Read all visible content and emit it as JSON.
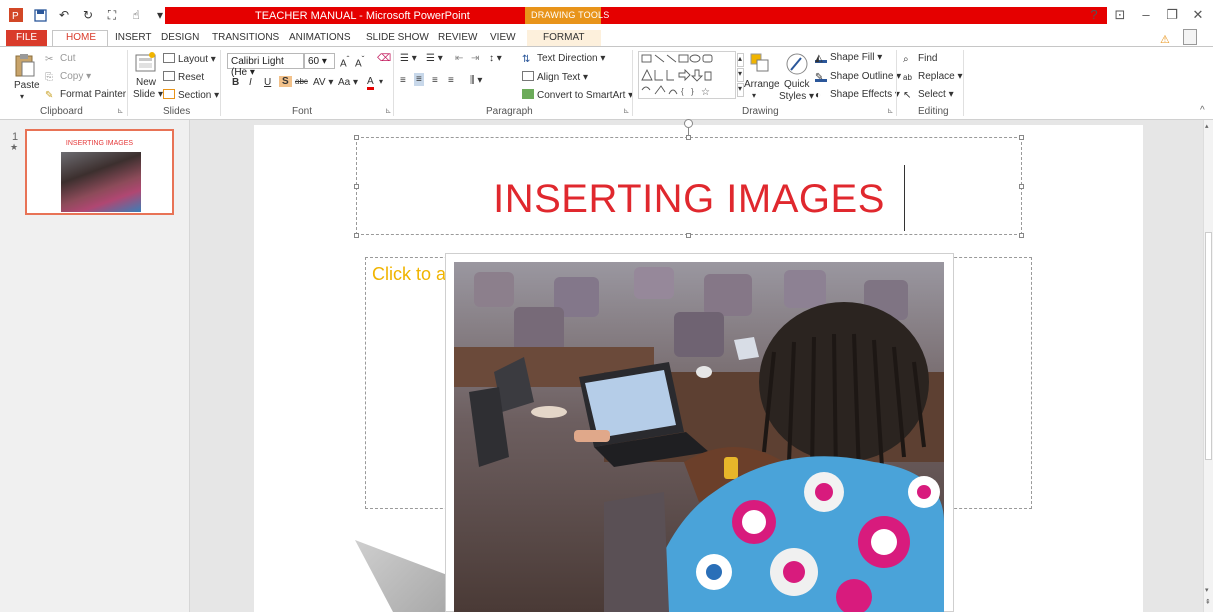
{
  "app": {
    "title": "TEACHER MANUAL - Microsoft PowerPoint",
    "contextual_tab_group": "DRAWING TOOLS",
    "window_controls": [
      "?",
      "⊡",
      "–",
      "❐",
      "✕"
    ]
  },
  "tabs": [
    "FILE",
    "HOME",
    "INSERT",
    "DESIGN",
    "TRANSITIONS",
    "ANIMATIONS",
    "SLIDE SHOW",
    "REVIEW",
    "VIEW",
    "FORMAT"
  ],
  "ribbon": {
    "clipboard": {
      "label": "Clipboard",
      "paste": "Paste",
      "cut": "Cut",
      "copy": "Copy",
      "format_painter": "Format Painter"
    },
    "slides": {
      "label": "Slides",
      "new_slide_line1": "New",
      "new_slide_line2": "Slide",
      "layout": "Layout",
      "reset": "Reset",
      "section": "Section"
    },
    "font": {
      "label": "Font",
      "font_name": "Calibri Light (He",
      "font_size": "60",
      "bold": "B",
      "italic": "I",
      "underline": "U",
      "shadow": "S",
      "strikethrough": "abc",
      "char_spacing": "AV",
      "change_case": "Aa",
      "font_color": "A"
    },
    "paragraph": {
      "label": "Paragraph",
      "text_direction": "Text Direction",
      "align_text": "Align Text",
      "convert_smartart": "Convert to SmartArt"
    },
    "drawing": {
      "label": "Drawing",
      "arrange": "Arrange",
      "quick_styles_line1": "Quick",
      "quick_styles_line2": "Styles",
      "shape_fill": "Shape Fill",
      "shape_outline": "Shape Outline",
      "shape_effects": "Shape Effects"
    },
    "editing": {
      "label": "Editing",
      "find": "Find",
      "replace": "Replace",
      "select": "Select"
    }
  },
  "thumbnails": [
    {
      "number": "1",
      "star": "★",
      "title": "INSERTING IMAGES"
    }
  ],
  "slide": {
    "title": "INSERTING IMAGES",
    "content_placeholder": "Click to a"
  },
  "colors": {
    "title_red": "#e0282e",
    "titlebar_red": "#e50000",
    "drawing_tools_orange": "#e8941a",
    "placeholder_yellow": "#f0b400",
    "file_tab": "#d93b2b"
  }
}
